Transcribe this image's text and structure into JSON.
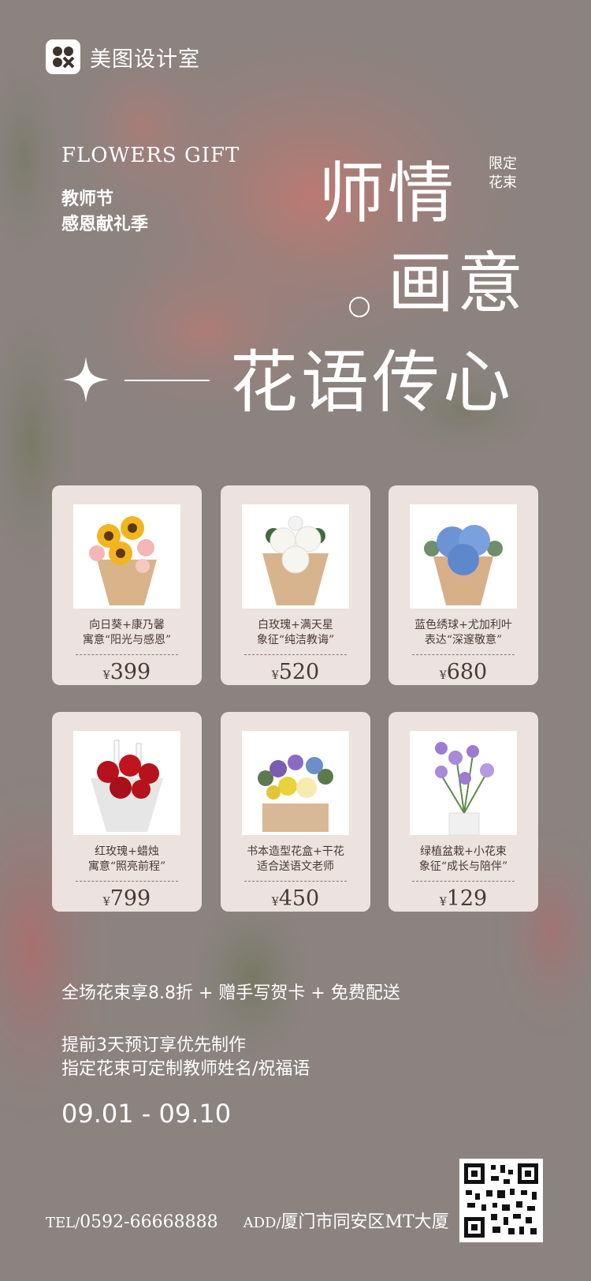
{
  "brand": {
    "name": "美图设计室"
  },
  "header": {
    "en_title": "FLOWERS GIFT",
    "sub_line1": "教师节",
    "sub_line2": "感恩献礼季",
    "title_line1": "师情",
    "title_line2": "画意",
    "title_line3": "花语传心",
    "limited_tag": "限定花束"
  },
  "products": [
    {
      "line1": "向日葵+康乃馨",
      "line2": "寓意“阳光与感恩”",
      "currency": "¥",
      "price": "399",
      "image": "sunflower-bouquet"
    },
    {
      "line1": "白玫瑰+满天星",
      "line2": "象征“纯洁教诲”",
      "currency": "¥",
      "price": "520",
      "image": "white-rose-bouquet"
    },
    {
      "line1": "蓝色绣球+尤加利叶",
      "line2": "表达“深邃敬意”",
      "currency": "¥",
      "price": "680",
      "image": "blue-hydrangea-bouquet"
    },
    {
      "line1": "红玫瑰+蜡烛",
      "line2": "寓意“照亮前程”",
      "currency": "¥",
      "price": "799",
      "image": "red-rose-candle-bouquet"
    },
    {
      "line1": "书本造型花盒+干花",
      "line2": "适合送语文老师",
      "currency": "¥",
      "price": "450",
      "image": "book-flower-box"
    },
    {
      "line1": "绿植盆栽+小花束",
      "line2": "象征“成长与陪伴”",
      "currency": "¥",
      "price": "129",
      "image": "potted-plant"
    }
  ],
  "promo": {
    "offer": "全场花束享8.8折 + 赠手写贺卡 + 免费配送",
    "note1": "提前3天预订享优先制作",
    "note2": "指定花束可定制教师姓名/祝福语",
    "dates": "09.01 - 09.10"
  },
  "contact": {
    "tel_label": "TEL/",
    "tel": "0592-66668888",
    "add_label": "ADD/",
    "address": "厦门市同安区MT大厦"
  },
  "colors": {
    "background": "#8a8380",
    "card": "#ece2df",
    "card_text": "#4a3a36"
  }
}
